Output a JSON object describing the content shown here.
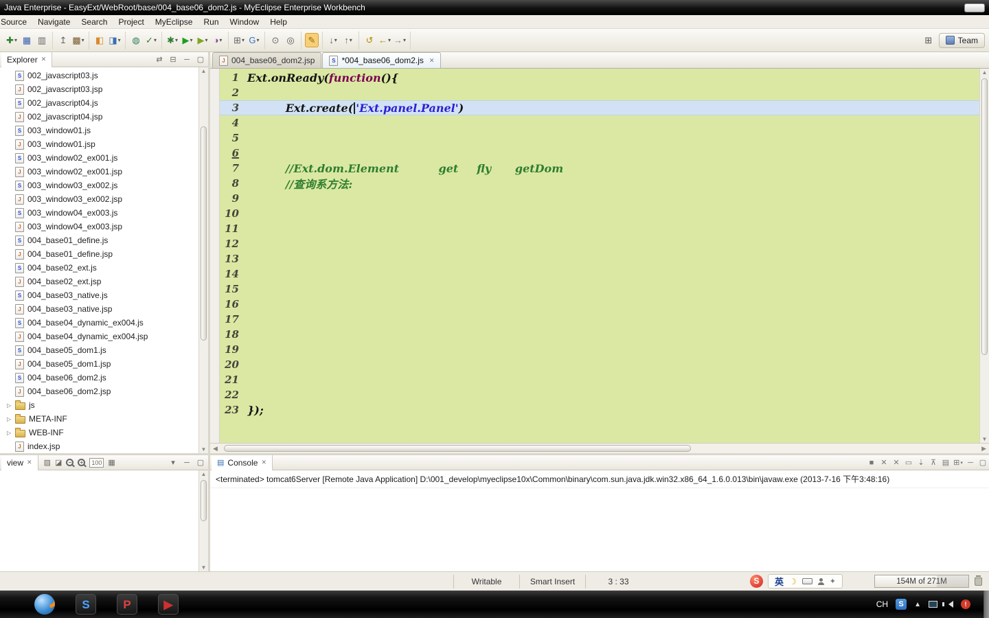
{
  "window": {
    "title": "Java Enterprise - EasyExt/WebRoot/base/004_base06_dom2.js - MyEclipse Enterprise Workbench"
  },
  "menu": {
    "items": [
      "Source",
      "Navigate",
      "Search",
      "Project",
      "MyEclipse",
      "Run",
      "Window",
      "Help"
    ]
  },
  "perspective": {
    "label": "Team"
  },
  "toolbar": {
    "groups": [
      [
        {
          "name": "new-file",
          "glyph": "✚",
          "color": "#2f7d2f",
          "dd": true
        },
        {
          "name": "save",
          "glyph": "▦",
          "color": "#3a5fae"
        },
        {
          "name": "print",
          "glyph": "▥",
          "color": "#666"
        }
      ],
      [
        {
          "name": "export-archive",
          "glyph": "↥",
          "color": "#666"
        },
        {
          "name": "database-explorer",
          "glyph": "▩",
          "color": "#7a5c2e",
          "dd": true
        }
      ],
      [
        {
          "name": "deploy-project",
          "glyph": "◧",
          "color": "#d8892a"
        },
        {
          "name": "application-server",
          "glyph": "◨",
          "color": "#3a6fb0",
          "dd": true
        }
      ],
      [
        {
          "name": "web-browser",
          "glyph": "◍",
          "color": "#2e7d5b"
        },
        {
          "name": "validate",
          "glyph": "✓",
          "color": "#2f7d2f",
          "dd": true
        }
      ],
      [
        {
          "name": "debug",
          "glyph": "✱",
          "color": "#2e7d32",
          "dd": true
        },
        {
          "name": "run",
          "glyph": "▶",
          "color": "#1f9d1f",
          "dd": true
        },
        {
          "name": "coverage",
          "glyph": "▶",
          "color": "#7da622",
          "dd": true
        },
        {
          "name": "profile",
          "glyph": "◑",
          "color": "#8a4a9d",
          "dd": true
        }
      ],
      [
        {
          "name": "new-java-element",
          "glyph": "⊞",
          "color": "#666",
          "dd": true
        },
        {
          "name": "google-toolbar",
          "glyph": "G",
          "color": "#3a6fc4",
          "dd": true
        }
      ],
      [
        {
          "name": "open-type",
          "glyph": "⊙",
          "color": "#666"
        },
        {
          "name": "search",
          "glyph": "◎",
          "color": "#555"
        }
      ],
      [
        {
          "name": "mark-occurrences",
          "glyph": "✎",
          "color": "#9a6a00",
          "sel": true
        }
      ],
      [
        {
          "name": "next-annotation",
          "glyph": "↓",
          "color": "#666",
          "dd": true
        },
        {
          "name": "previous-annotation",
          "glyph": "↑",
          "color": "#666",
          "dd": true
        }
      ],
      [
        {
          "name": "last-edit-location",
          "glyph": "↺",
          "color": "#b08c00"
        },
        {
          "name": "back",
          "glyph": "←",
          "color": "#b08c00",
          "dd": true
        },
        {
          "name": "forward",
          "glyph": "→",
          "color": "#888",
          "dd": true
        }
      ]
    ]
  },
  "explorer": {
    "title": "Explorer",
    "items": [
      {
        "label": "002_javascript03.js",
        "type": "js"
      },
      {
        "label": "002_javascript03.jsp",
        "type": "jsp"
      },
      {
        "label": "002_javascript04.js",
        "type": "js"
      },
      {
        "label": "002_javascript04.jsp",
        "type": "jsp"
      },
      {
        "label": "003_window01.js",
        "type": "js"
      },
      {
        "label": "003_window01.jsp",
        "type": "jsp"
      },
      {
        "label": "003_window02_ex001.js",
        "type": "js"
      },
      {
        "label": "003_window02_ex001.jsp",
        "type": "jsp"
      },
      {
        "label": "003_window03_ex002.js",
        "type": "js"
      },
      {
        "label": "003_window03_ex002.jsp",
        "type": "jsp"
      },
      {
        "label": "003_window04_ex003.js",
        "type": "js"
      },
      {
        "label": "003_window04_ex003.jsp",
        "type": "jsp"
      },
      {
        "label": "004_base01_define.js",
        "type": "js"
      },
      {
        "label": "004_base01_define.jsp",
        "type": "jsp"
      },
      {
        "label": "004_base02_ext.js",
        "type": "js"
      },
      {
        "label": "004_base02_ext.jsp",
        "type": "jsp"
      },
      {
        "label": "004_base03_native.js",
        "type": "js"
      },
      {
        "label": "004_base03_native.jsp",
        "type": "jsp"
      },
      {
        "label": "004_base04_dynamic_ex004.js",
        "type": "js"
      },
      {
        "label": "004_base04_dynamic_ex004.jsp",
        "type": "jsp"
      },
      {
        "label": "004_base05_dom1.js",
        "type": "js"
      },
      {
        "label": "004_base05_dom1.jsp",
        "type": "jsp"
      },
      {
        "label": "004_base06_dom2.js",
        "type": "js"
      },
      {
        "label": "004_base06_dom2.jsp",
        "type": "jsp"
      },
      {
        "label": "js",
        "type": "folder"
      },
      {
        "label": "META-INF",
        "type": "folder"
      },
      {
        "label": "WEB-INF",
        "type": "folder"
      },
      {
        "label": "index.jsp",
        "type": "jsp"
      }
    ]
  },
  "editor": {
    "tabs": [
      {
        "label": "004_base06_dom2.jsp",
        "type": "jsp",
        "active": false
      },
      {
        "label": "*004_base06_dom2.js",
        "type": "js",
        "active": true
      }
    ],
    "lines": [
      {
        "n": 1,
        "segs": [
          {
            "t": "Ext.onReady(",
            "s": "plain"
          },
          {
            "t": "function",
            "s": "kw"
          },
          {
            "t": "(){",
            "s": "plain"
          }
        ]
      },
      {
        "n": 2,
        "segs": []
      },
      {
        "n": 3,
        "current": true,
        "segs": [
          {
            "t": "\tExt.create(",
            "s": "plain"
          },
          {
            "caret": true
          },
          {
            "t": "'Ext.panel.Panel'",
            "s": "str"
          },
          {
            "t": ")",
            "s": "plain"
          }
        ]
      },
      {
        "n": 4,
        "segs": []
      },
      {
        "n": 5,
        "segs": []
      },
      {
        "n": 6,
        "mark": true,
        "segs": []
      },
      {
        "n": 7,
        "segs": [
          {
            "t": "\t//Ext.dom.Element\tget\tfly\tgetDom",
            "s": "com"
          }
        ]
      },
      {
        "n": 8,
        "segs": [
          {
            "t": "\t//查询系方法:",
            "s": "com"
          }
        ]
      },
      {
        "n": 9,
        "segs": []
      },
      {
        "n": 10,
        "segs": []
      },
      {
        "n": 11,
        "segs": []
      },
      {
        "n": 12,
        "segs": []
      },
      {
        "n": 13,
        "segs": []
      },
      {
        "n": 14,
        "segs": []
      },
      {
        "n": 15,
        "segs": []
      },
      {
        "n": 16,
        "segs": []
      },
      {
        "n": 17,
        "segs": []
      },
      {
        "n": 18,
        "segs": []
      },
      {
        "n": 19,
        "segs": []
      },
      {
        "n": 20,
        "segs": []
      },
      {
        "n": 21,
        "segs": []
      },
      {
        "n": 22,
        "segs": []
      },
      {
        "n": 23,
        "segs": [
          {
            "t": "});",
            "s": "plain"
          }
        ]
      }
    ]
  },
  "preview": {
    "title": "view",
    "toolbar": [
      {
        "name": "palette",
        "kind": "glyph",
        "glyph": "▨"
      },
      {
        "name": "chart",
        "kind": "glyph",
        "glyph": "◪"
      },
      {
        "name": "zoom-out",
        "kind": "mag",
        "sign": "−"
      },
      {
        "name": "zoom-in",
        "kind": "mag",
        "sign": "+"
      },
      {
        "name": "zoom-level",
        "kind": "text",
        "text": "100"
      },
      {
        "name": "thumbnails",
        "kind": "glyph",
        "glyph": "▦"
      }
    ]
  },
  "console": {
    "tab": "Console",
    "message": "<terminated> tomcat6Server [Remote Java Application] D:\\001_develop\\myeclipse10x\\Common\\binary\\com.sun.java.jdk.win32.x86_64_1.6.0.013\\bin\\javaw.exe (2013-7-16 下午3:48:16)",
    "toolbar": [
      {
        "name": "terminate",
        "glyph": "■"
      },
      {
        "name": "remove-launch",
        "glyph": "✕"
      },
      {
        "name": "remove-all-terminated",
        "glyph": "✕"
      },
      {
        "name": "clear-console",
        "glyph": "▭"
      },
      {
        "name": "scroll-lock",
        "glyph": "⇣"
      },
      {
        "name": "pin-console",
        "glyph": "⊼"
      },
      {
        "name": "display-selected-console",
        "glyph": "▤"
      },
      {
        "name": "open-console",
        "glyph": "⊞",
        "dd": true
      },
      {
        "name": "minimize",
        "glyph": "─"
      },
      {
        "name": "maximize",
        "glyph": "▢"
      }
    ]
  },
  "statusbar": {
    "writable": "Writable",
    "insert_mode": "Smart Insert",
    "position": "3 : 33",
    "heap": "154M of 271M",
    "ime_lang": "英"
  },
  "taskbar": {
    "apps": [
      {
        "name": "firefox",
        "kind": "firefox"
      },
      {
        "name": "app-s",
        "kind": "letter",
        "letter": "S",
        "color": "#4aa3ff"
      },
      {
        "name": "app-p",
        "kind": "letter",
        "letter": "P",
        "color": "#e04040"
      },
      {
        "name": "media-player",
        "kind": "letter",
        "letter": "▶",
        "color": "#d03030"
      }
    ],
    "tray_lang": "CH"
  }
}
